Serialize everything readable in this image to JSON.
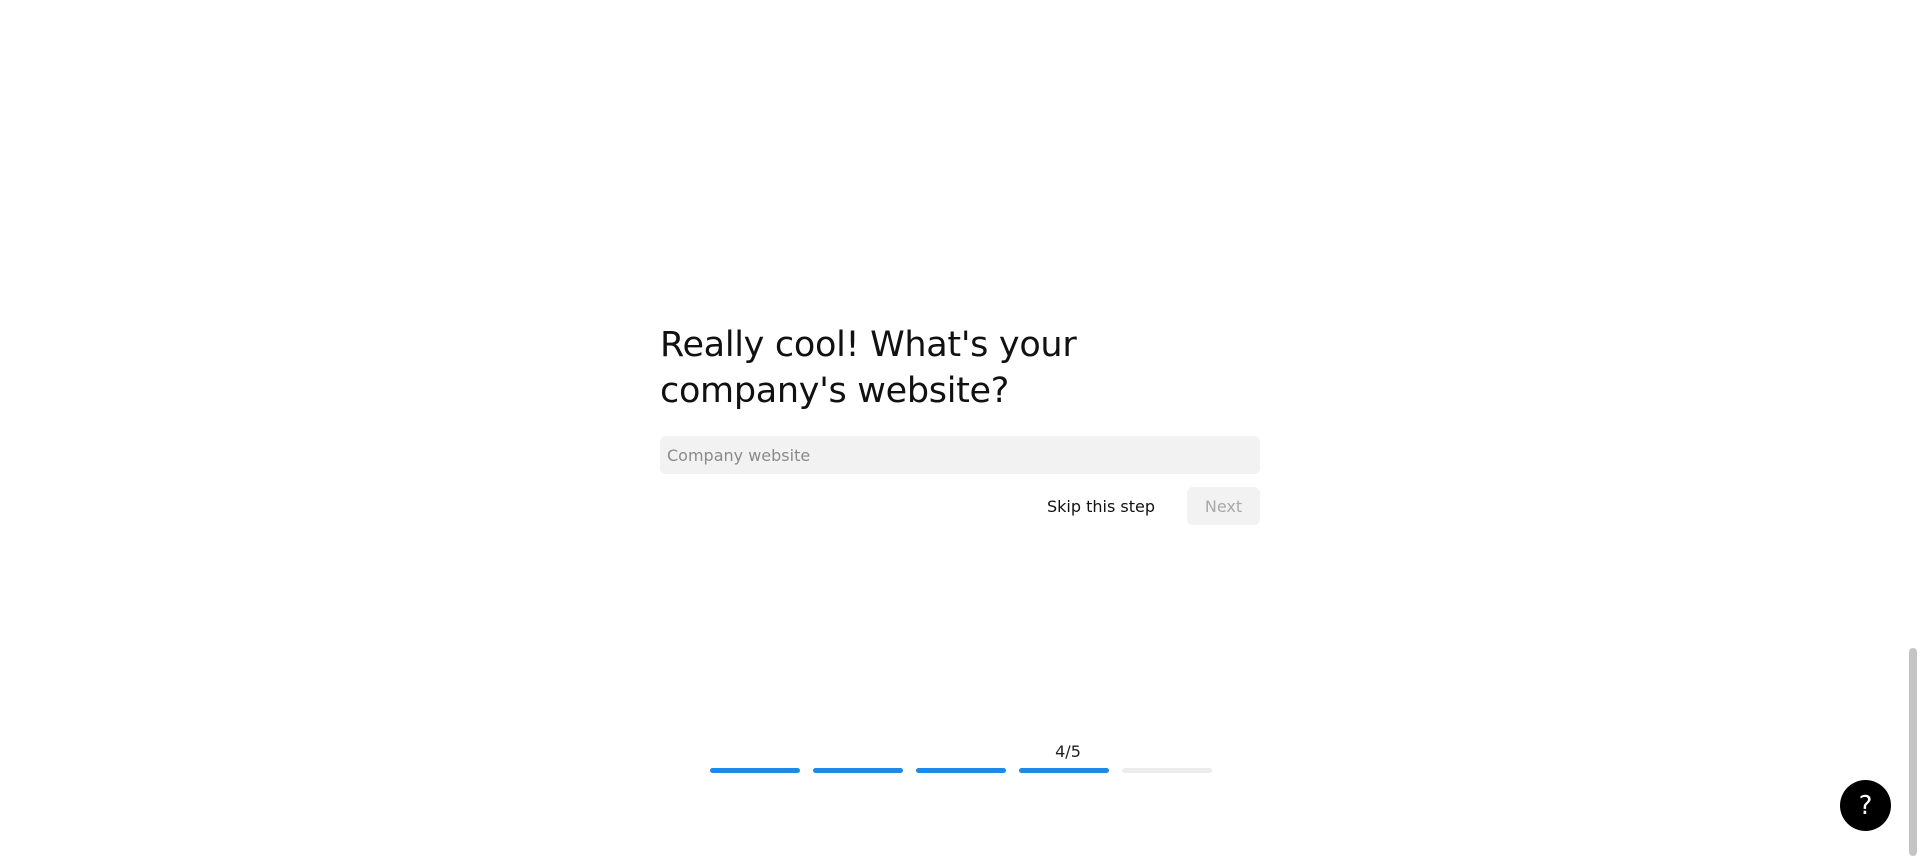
{
  "question": {
    "title": "Really cool! What's your company's website?"
  },
  "website_input": {
    "placeholder": "Company website",
    "value": ""
  },
  "actions": {
    "skip_label": "Skip this step",
    "next_label": "Next"
  },
  "progress": {
    "label": "4/5",
    "current_step": 4,
    "total_steps": 5
  },
  "help": {
    "icon": "question-mark-icon",
    "glyph": "?"
  },
  "colors": {
    "accent": "#1d8ae8",
    "inactive_track": "#ececec",
    "input_background": "#f2f2f2",
    "help_button": "#000000"
  }
}
